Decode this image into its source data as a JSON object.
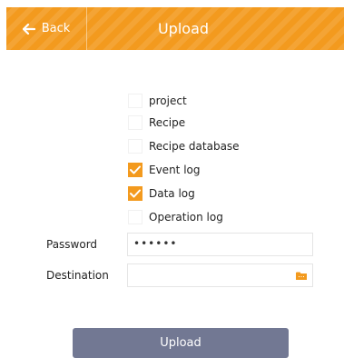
{
  "colors": {
    "accent": "#f39a1e",
    "button": "#727893"
  },
  "header": {
    "back_label": "Back",
    "back_icon": "arrow-left-icon",
    "title": "Upload"
  },
  "options": [
    {
      "label": "project",
      "checked": false
    },
    {
      "label": "Recipe",
      "checked": false
    },
    {
      "label": "Recipe database",
      "checked": false
    },
    {
      "label": "Event log",
      "checked": true
    },
    {
      "label": "Data log",
      "checked": true
    },
    {
      "label": "Operation log",
      "checked": false
    }
  ],
  "password": {
    "label": "Password",
    "value": "••••••"
  },
  "destination": {
    "label": "Destination",
    "value": "",
    "icon": "folder-icon"
  },
  "upload_button": {
    "label": "Upload"
  }
}
